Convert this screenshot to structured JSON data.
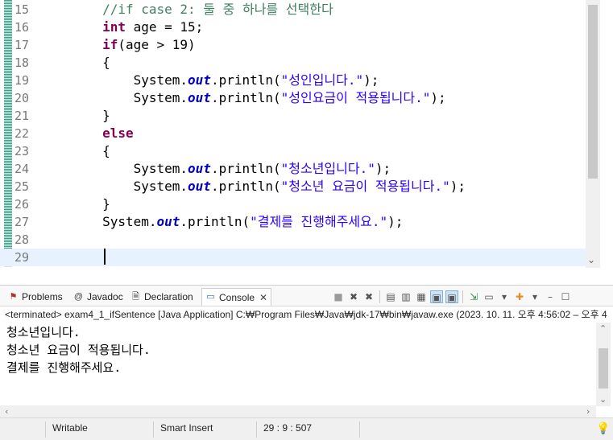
{
  "editor": {
    "lines": [
      {
        "num": "15",
        "text": "        //if case 2: 둘 중 하나를 선택한다"
      },
      {
        "num": "16",
        "text": "        int age = 15;"
      },
      {
        "num": "17",
        "text": "        if(age > 19)"
      },
      {
        "num": "18",
        "text": "        {"
      },
      {
        "num": "19",
        "text": "            System.out.println(\"성인입니다.\");"
      },
      {
        "num": "20",
        "text": "            System.out.println(\"성인요금이 적용됩니다.\");"
      },
      {
        "num": "21",
        "text": "        }"
      },
      {
        "num": "22",
        "text": "        else"
      },
      {
        "num": "23",
        "text": "        {"
      },
      {
        "num": "24",
        "text": "            System.out.println(\"청소년입니다.\");"
      },
      {
        "num": "25",
        "text": "            System.out.println(\"청소년 요금이 적용됩니다.\");"
      },
      {
        "num": "26",
        "text": "        }"
      },
      {
        "num": "27",
        "text": "        System.out.println(\"결제를 진행해주세요.\");"
      },
      {
        "num": "28",
        "text": ""
      },
      {
        "num": "29",
        "text": ""
      }
    ],
    "current_line": "29"
  },
  "panel": {
    "tabs": [
      {
        "label": "Problems",
        "icon": "problems-icon"
      },
      {
        "label": "Javadoc",
        "icon": "javadoc-icon"
      },
      {
        "label": "Declaration",
        "icon": "declaration-icon"
      },
      {
        "label": "Console",
        "icon": "console-icon",
        "active": true
      }
    ],
    "terminated": "<terminated> exam4_1_ifSentence [Java Application] C:₩Program Files₩Java₩jdk-17₩bin₩javaw.exe  (2023. 10. 11. 오후 4:56:02 – 오후 4",
    "output": [
      "청소년입니다.",
      "청소년 요금이 적용됩니다.",
      "결제를 진행해주세요."
    ]
  },
  "status": {
    "writable": "Writable",
    "insert_mode": "Smart Insert",
    "position": "29 : 9 : 507"
  },
  "colors": {
    "keyword": "#7f0055",
    "string": "#2a00ff",
    "comment": "#3f7f5f",
    "field": "#0000c0",
    "current_line": "#e8f2fe"
  }
}
